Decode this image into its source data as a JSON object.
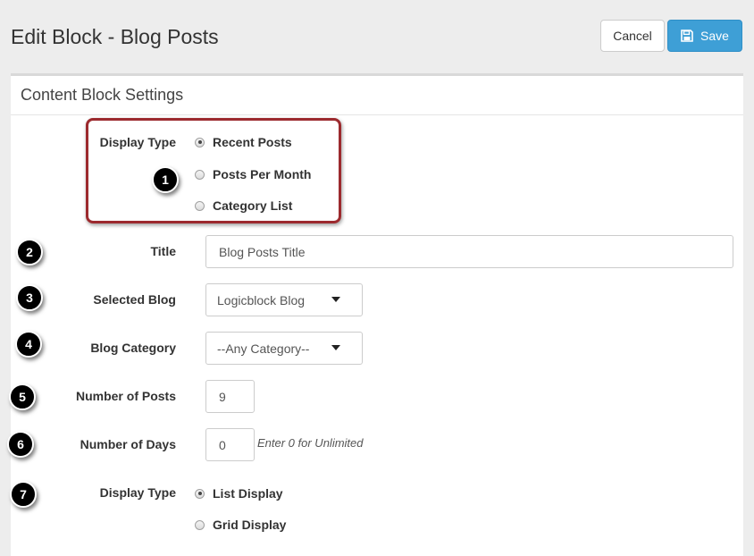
{
  "header": {
    "title": "Edit Block - Blog Posts",
    "cancel_label": "Cancel",
    "save_label": "Save",
    "save_icon": "floppy-disk-icon",
    "save_color": "#3e9fd6"
  },
  "panel": {
    "title": "Content Block Settings"
  },
  "form": {
    "display_type_1": {
      "label": "Display Type",
      "options": [
        "Recent Posts",
        "Posts Per Month",
        "Category List"
      ],
      "selected": "Recent Posts"
    },
    "title": {
      "label": "Title",
      "value": "Blog Posts Title"
    },
    "selected_blog": {
      "label": "Selected Blog",
      "value": "Logicblock Blog"
    },
    "blog_category": {
      "label": "Blog Category",
      "value": "--Any Category--"
    },
    "number_of_posts": {
      "label": "Number of Posts",
      "value": "9"
    },
    "number_of_days": {
      "label": "Number of Days",
      "value": "0",
      "help": "Enter 0 for Unlimited"
    },
    "display_type_2": {
      "label": "Display Type",
      "options": [
        "List Display",
        "Grid Display"
      ],
      "selected": "List Display"
    }
  },
  "annotations": {
    "badges": [
      "1",
      "2",
      "3",
      "4",
      "5",
      "6",
      "7"
    ],
    "highlight_color": "#9c2a2e"
  }
}
